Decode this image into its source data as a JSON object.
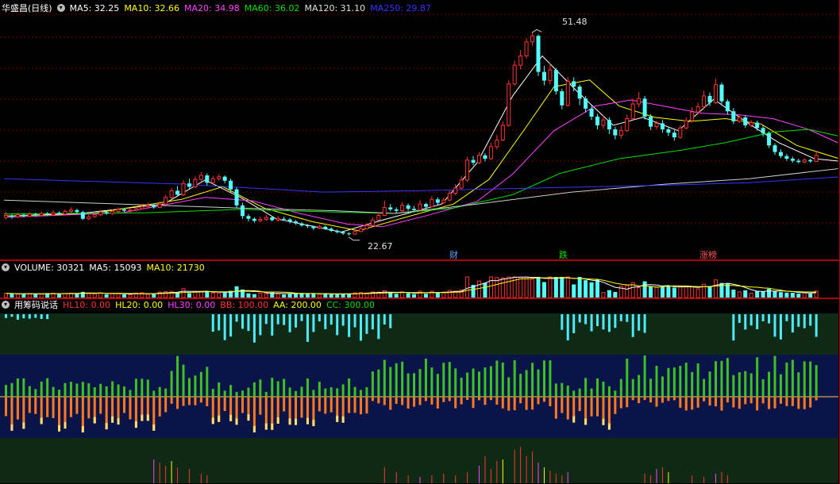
{
  "app": {
    "stock_name": "华盛昌",
    "period": "(日线)"
  },
  "colors": {
    "up": "#ff3232",
    "down": "#54ffff",
    "ma5": "#ffffff",
    "ma10": "#ffff00",
    "ma20": "#ff00ff",
    "ma60": "#00e000",
    "ma120": "#cccccc",
    "ma250": "#3535ff",
    "grid": "#7a0000",
    "bg_green": "#0f2a14",
    "bg_navy": "#0a1448"
  },
  "main": {
    "legend": [
      {
        "label": "MA5: 32.25",
        "color": "#ffffff"
      },
      {
        "label": "MA10: 32.66",
        "color": "#ffff00"
      },
      {
        "label": "MA20: 34.98",
        "color": "#ff40ff"
      },
      {
        "label": "MA60: 36.02",
        "color": "#00e000"
      },
      {
        "label": "MA120: 31.10",
        "color": "#e0e0e0"
      },
      {
        "label": "MA250: 29.87",
        "color": "#3535ff"
      }
    ],
    "high_label": "51.48",
    "low_label": "22.67",
    "tags": [
      {
        "text": "财",
        "color": "#54a8ff"
      },
      {
        "text": "跌",
        "color": "#00e000"
      },
      {
        "text": "涨榜",
        "color": "#ff5050"
      }
    ]
  },
  "volume": {
    "legend": [
      {
        "label": "VOLUME: 30321",
        "color": "#ffffff"
      },
      {
        "label": "MA5: 15093",
        "color": "#ffffff"
      },
      {
        "label": "MA10: 21730",
        "color": "#ffff00"
      }
    ]
  },
  "indicator": {
    "title": "用筹码说话",
    "legend": [
      {
        "label": "HL10: 0.00",
        "color": "#ff3232"
      },
      {
        "label": "HL20: 0.00",
        "color": "#ffff00"
      },
      {
        "label": "HL30: 0.00",
        "color": "#ff40ff"
      },
      {
        "label": "BB: 100.00",
        "color": "#ff3232"
      },
      {
        "label": "AA: 200.00",
        "color": "#ffff00"
      },
      {
        "label": "CC: 300.00",
        "color": "#00e000"
      }
    ]
  },
  "chart_data": {
    "type": "candlestick",
    "price_range": [
      20,
      54
    ],
    "candles": [
      [
        23.8,
        24.1,
        24.6,
        23.5
      ],
      [
        24.1,
        23.9,
        24.3,
        23.6
      ],
      [
        23.9,
        24.2,
        24.5,
        23.7
      ],
      [
        24.2,
        24.0,
        24.4,
        23.8
      ],
      [
        24.0,
        24.3,
        24.6,
        23.9
      ],
      [
        24.3,
        24.1,
        24.5,
        23.9
      ],
      [
        24.1,
        24.4,
        24.7,
        24.0
      ],
      [
        24.4,
        24.2,
        24.6,
        24.0
      ],
      [
        24.2,
        24.5,
        24.9,
        24.1
      ],
      [
        24.5,
        24.3,
        24.7,
        24.1
      ],
      [
        24.3,
        24.7,
        25.0,
        24.2
      ],
      [
        24.7,
        24.9,
        25.3,
        24.5
      ],
      [
        24.9,
        24.6,
        25.1,
        24.4
      ],
      [
        24.6,
        23.6,
        24.8,
        23.4
      ],
      [
        23.6,
        23.9,
        24.2,
        23.4
      ],
      [
        23.9,
        24.2,
        24.5,
        23.8
      ],
      [
        24.2,
        24.6,
        24.9,
        24.0
      ],
      [
        24.6,
        24.4,
        24.8,
        24.2
      ],
      [
        24.4,
        24.7,
        25.0,
        24.2
      ],
      [
        24.7,
        25.0,
        25.3,
        24.5
      ],
      [
        25.0,
        24.8,
        25.2,
        24.6
      ],
      [
        24.8,
        24.9,
        25.2,
        24.5
      ],
      [
        24.9,
        25.1,
        25.4,
        24.7
      ],
      [
        25.1,
        25.4,
        25.8,
        25.0
      ],
      [
        25.4,
        25.6,
        26.0,
        25.2
      ],
      [
        25.6,
        25.3,
        25.9,
        25.1
      ],
      [
        25.3,
        25.8,
        26.2,
        25.2
      ],
      [
        25.8,
        26.8,
        27.2,
        25.6
      ],
      [
        26.8,
        27.8,
        28.2,
        26.6
      ],
      [
        27.8,
        27.2,
        28.5,
        27.0
      ],
      [
        27.2,
        28.9,
        29.4,
        27.0
      ],
      [
        28.9,
        28.4,
        29.6,
        28.1
      ],
      [
        28.4,
        29.5,
        30.0,
        28.2
      ],
      [
        29.5,
        30.1,
        30.6,
        29.2
      ],
      [
        30.1,
        29.0,
        30.4,
        28.6
      ],
      [
        29.0,
        29.6,
        30.0,
        28.8
      ],
      [
        29.6,
        29.9,
        30.3,
        29.3
      ],
      [
        29.9,
        29.3,
        30.1,
        28.9
      ],
      [
        29.3,
        28.0,
        29.6,
        27.6
      ],
      [
        28.0,
        25.6,
        28.3,
        25.2
      ],
      [
        25.6,
        24.0,
        26.0,
        23.6
      ],
      [
        24.0,
        23.6,
        24.3,
        23.2
      ],
      [
        23.6,
        23.3,
        23.8,
        23.0
      ],
      [
        23.3,
        23.5,
        23.9,
        23.1
      ],
      [
        23.5,
        23.8,
        24.2,
        23.3
      ],
      [
        23.8,
        23.4,
        24.0,
        23.2
      ],
      [
        23.4,
        23.6,
        24.0,
        23.2
      ],
      [
        23.6,
        23.5,
        23.9,
        23.3
      ],
      [
        23.5,
        23.2,
        23.7,
        22.9
      ],
      [
        23.2,
        22.9,
        23.4,
        22.7
      ],
      [
        22.9,
        22.6,
        23.1,
        22.4
      ],
      [
        22.6,
        22.5,
        22.8,
        22.2
      ],
      [
        22.5,
        22.2,
        22.6,
        21.9
      ],
      [
        22.2,
        22.4,
        22.7,
        22.0
      ],
      [
        22.4,
        22.1,
        22.6,
        21.9
      ],
      [
        22.1,
        21.8,
        22.3,
        21.6
      ],
      [
        21.8,
        21.6,
        22.0,
        21.4
      ],
      [
        21.6,
        21.4,
        21.8,
        21.2
      ],
      [
        21.4,
        21.3,
        21.6,
        21.1
      ],
      [
        21.3,
        21.7,
        21.9,
        21.2
      ],
      [
        21.7,
        22.1,
        22.5,
        21.6
      ],
      [
        22.1,
        22.6,
        22.9,
        22.0
      ],
      [
        22.6,
        23.4,
        23.8,
        22.5
      ],
      [
        23.4,
        24.1,
        24.6,
        23.3
      ],
      [
        24.1,
        25.3,
        26.3,
        24.0
      ],
      [
        25.3,
        25.0,
        25.8,
        24.7
      ],
      [
        25.0,
        24.8,
        25.3,
        24.5
      ],
      [
        24.8,
        25.6,
        26.1,
        24.6
      ],
      [
        25.6,
        25.1,
        25.9,
        24.8
      ],
      [
        25.1,
        24.9,
        25.5,
        24.6
      ],
      [
        24.9,
        25.8,
        26.4,
        24.8
      ],
      [
        25.8,
        25.4,
        26.0,
        25.0
      ],
      [
        25.4,
        26.5,
        27.0,
        25.3
      ],
      [
        26.5,
        26.0,
        26.8,
        25.7
      ],
      [
        26.0,
        26.4,
        26.8,
        25.8
      ],
      [
        26.4,
        27.4,
        27.8,
        26.2
      ],
      [
        27.4,
        28.2,
        28.8,
        27.1
      ],
      [
        28.2,
        29.4,
        30.0,
        28.0
      ],
      [
        29.4,
        32.4,
        32.9,
        29.1
      ],
      [
        32.4,
        32.0,
        33.0,
        31.6
      ],
      [
        32.0,
        33.1,
        33.6,
        31.8
      ],
      [
        33.1,
        32.6,
        33.4,
        32.2
      ],
      [
        32.6,
        34.4,
        35.0,
        32.4
      ],
      [
        34.4,
        35.4,
        36.2,
        34.0
      ],
      [
        35.4,
        37.6,
        38.2,
        35.2
      ],
      [
        37.6,
        43.8,
        44.4,
        37.4
      ],
      [
        43.8,
        46.6,
        47.3,
        43.5
      ],
      [
        46.6,
        48.0,
        48.9,
        46.0
      ],
      [
        48.0,
        50.1,
        50.7,
        47.6
      ],
      [
        50.1,
        51.0,
        51.48,
        49.5
      ],
      [
        51.0,
        45.6,
        51.2,
        45.0
      ],
      [
        45.6,
        44.3,
        46.5,
        43.6
      ],
      [
        44.3,
        45.9,
        46.9,
        43.7
      ],
      [
        45.9,
        42.7,
        46.2,
        42.2
      ],
      [
        42.7,
        40.6,
        43.1,
        40.0
      ],
      [
        40.6,
        44.2,
        44.8,
        40.4
      ],
      [
        44.2,
        43.4,
        44.8,
        42.7
      ],
      [
        43.4,
        41.6,
        43.7,
        40.6
      ],
      [
        41.6,
        40.1,
        42.0,
        39.5
      ],
      [
        40.1,
        38.9,
        40.6,
        38.4
      ],
      [
        38.9,
        37.6,
        39.3,
        37.0
      ],
      [
        37.6,
        38.4,
        39.0,
        37.1
      ],
      [
        38.4,
        37.0,
        38.8,
        36.3
      ],
      [
        37.0,
        36.1,
        37.4,
        35.5
      ],
      [
        36.1,
        36.8,
        37.5,
        35.6
      ],
      [
        36.8,
        38.6,
        39.2,
        36.6
      ],
      [
        38.6,
        40.8,
        41.6,
        38.4
      ],
      [
        40.8,
        41.6,
        42.6,
        40.3
      ],
      [
        41.6,
        38.9,
        42.0,
        38.5
      ],
      [
        38.9,
        37.4,
        39.3,
        36.9
      ],
      [
        37.4,
        37.9,
        38.3,
        37.0
      ],
      [
        37.9,
        37.0,
        38.4,
        36.5
      ],
      [
        37.0,
        36.5,
        37.4,
        36.0
      ],
      [
        36.5,
        35.8,
        36.9,
        35.3
      ],
      [
        35.8,
        37.2,
        37.6,
        35.6
      ],
      [
        37.2,
        38.3,
        38.8,
        37.0
      ],
      [
        38.3,
        39.6,
        40.3,
        38.0
      ],
      [
        39.6,
        40.4,
        41.0,
        39.2
      ],
      [
        40.4,
        42.0,
        42.8,
        40.1
      ],
      [
        42.0,
        41.0,
        42.5,
        40.5
      ],
      [
        41.0,
        43.7,
        44.6,
        40.8
      ],
      [
        43.7,
        41.2,
        44.0,
        40.8
      ],
      [
        41.2,
        39.7,
        41.5,
        39.2
      ],
      [
        39.7,
        38.2,
        40.2,
        37.8
      ],
      [
        38.2,
        38.8,
        39.2,
        37.9
      ],
      [
        38.8,
        37.6,
        39.1,
        37.2
      ],
      [
        37.6,
        38.0,
        38.4,
        37.3
      ],
      [
        38.0,
        37.2,
        38.3,
        36.8
      ],
      [
        37.2,
        36.4,
        37.6,
        35.9
      ],
      [
        36.4,
        34.6,
        36.7,
        34.2
      ],
      [
        34.6,
        33.6,
        34.9,
        33.2
      ],
      [
        33.6,
        33.0,
        34.0,
        32.7
      ],
      [
        33.0,
        32.6,
        33.3,
        32.3
      ],
      [
        32.6,
        32.3,
        32.9,
        32.0
      ],
      [
        32.3,
        32.1,
        32.6,
        31.9
      ],
      [
        32.1,
        32.4,
        32.7,
        31.9
      ],
      [
        32.4,
        32.2,
        32.6,
        32.0
      ],
      [
        32.2,
        33.1,
        33.8,
        32.1
      ]
    ],
    "ma_lines": [
      {
        "name": "MA5",
        "color": "#ffffff",
        "values": [
          [
            0,
            24.0
          ],
          [
            13,
            24.4
          ],
          [
            27,
            25.8
          ],
          [
            34,
            29.4
          ],
          [
            40,
            26.8
          ],
          [
            46,
            23.6
          ],
          [
            57,
            21.6
          ],
          [
            64,
            23.4
          ],
          [
            74,
            25.8
          ],
          [
            80,
            32.0
          ],
          [
            86,
            42.0
          ],
          [
            91,
            48.0
          ],
          [
            97,
            42.6
          ],
          [
            103,
            37.6
          ],
          [
            108,
            38.8
          ],
          [
            114,
            36.8
          ],
          [
            120,
            41.5
          ],
          [
            126,
            37.8
          ],
          [
            131,
            35.0
          ],
          [
            137,
            32.6
          ],
          [
            141,
            32.25
          ]
        ]
      },
      {
        "name": "MA10",
        "color": "#ffff00",
        "values": [
          [
            0,
            24.0
          ],
          [
            15,
            24.4
          ],
          [
            30,
            26.5
          ],
          [
            37,
            28.4
          ],
          [
            44,
            25.2
          ],
          [
            52,
            23.2
          ],
          [
            60,
            21.8
          ],
          [
            67,
            23.6
          ],
          [
            76,
            25.8
          ],
          [
            82,
            29.5
          ],
          [
            88,
            37.0
          ],
          [
            93,
            43.4
          ],
          [
            99,
            44.4
          ],
          [
            104,
            40.5
          ],
          [
            110,
            38.8
          ],
          [
            116,
            38.2
          ],
          [
            122,
            38.6
          ],
          [
            128,
            37.8
          ],
          [
            134,
            34.6
          ],
          [
            141,
            32.66
          ]
        ]
      },
      {
        "name": "MA20",
        "color": "#ff40ff",
        "values": [
          [
            0,
            23.8
          ],
          [
            20,
            24.5
          ],
          [
            34,
            26.8
          ],
          [
            42,
            26.3
          ],
          [
            50,
            24.4
          ],
          [
            58,
            22.8
          ],
          [
            64,
            22.4
          ],
          [
            72,
            24.2
          ],
          [
            80,
            26.2
          ],
          [
            86,
            30.3
          ],
          [
            93,
            36.8
          ],
          [
            100,
            40.5
          ],
          [
            106,
            41.4
          ],
          [
            112,
            40.4
          ],
          [
            118,
            39.4
          ],
          [
            124,
            39.2
          ],
          [
            130,
            38.6
          ],
          [
            136,
            37.0
          ],
          [
            141,
            34.98
          ]
        ]
      },
      {
        "name": "MA60",
        "color": "#00e000",
        "values": [
          [
            0,
            24.3
          ],
          [
            24,
            24.5
          ],
          [
            40,
            25.0
          ],
          [
            56,
            24.6
          ],
          [
            66,
            24.4
          ],
          [
            76,
            25.2
          ],
          [
            86,
            27.2
          ],
          [
            94,
            30.4
          ],
          [
            104,
            32.6
          ],
          [
            114,
            33.8
          ],
          [
            122,
            35.0
          ],
          [
            130,
            36.6
          ],
          [
            136,
            37.0
          ],
          [
            141,
            36.02
          ]
        ]
      },
      {
        "name": "MA120",
        "color": "#cccccc",
        "values": [
          [
            0,
            26.4
          ],
          [
            20,
            25.8
          ],
          [
            40,
            25.2
          ],
          [
            56,
            24.8
          ],
          [
            66,
            24.4
          ],
          [
            80,
            25.8
          ],
          [
            96,
            27.6
          ],
          [
            112,
            28.8
          ],
          [
            126,
            29.6
          ],
          [
            141,
            31.1
          ]
        ]
      },
      {
        "name": "MA250",
        "color": "#3535ff",
        "values": [
          [
            0,
            29.6
          ],
          [
            30,
            28.8
          ],
          [
            54,
            27.6
          ],
          [
            70,
            27.8
          ],
          [
            90,
            28.2
          ],
          [
            110,
            28.6
          ],
          [
            126,
            29.0
          ],
          [
            141,
            29.87
          ]
        ]
      }
    ]
  }
}
